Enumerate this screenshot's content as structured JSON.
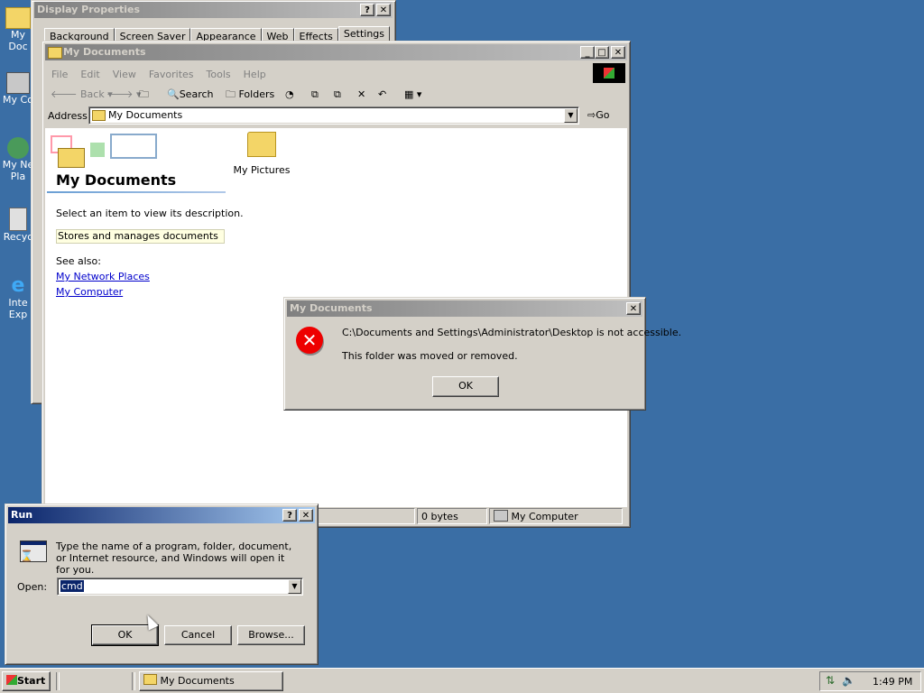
{
  "desktop": {
    "icons": [
      {
        "label": "My Doc"
      },
      {
        "label": "My Co"
      },
      {
        "label": "My Ne Pla"
      },
      {
        "label": "Recyc"
      },
      {
        "label": "Inte Exp"
      }
    ]
  },
  "display_properties": {
    "title": "Display Properties",
    "tabs": [
      "Background",
      "Screen Saver",
      "Appearance",
      "Web",
      "Effects",
      "Settings"
    ]
  },
  "explorer": {
    "title": "My Documents",
    "menu": [
      "File",
      "Edit",
      "View",
      "Favorites",
      "Tools",
      "Help"
    ],
    "toolbar": {
      "back": "Back",
      "search": "Search",
      "folders": "Folders"
    },
    "address_label": "Address",
    "address_value": "My Documents",
    "go_label": "Go",
    "panel_title": "My Documents",
    "panel_desc": "Select an item to view its description.",
    "panel_tooltip": "Stores and manages documents",
    "see_also": "See also:",
    "links": [
      "My Network Places",
      "My Computer"
    ],
    "items": [
      {
        "label": "My Pictures"
      }
    ],
    "status": {
      "size": "0 bytes",
      "zone": "My Computer"
    }
  },
  "error_dialog": {
    "title": "My Documents",
    "line1": "C:\\Documents and Settings\\Administrator\\Desktop is not accessible.",
    "line2": "This folder was moved or removed.",
    "ok": "OK"
  },
  "run_dialog": {
    "title": "Run",
    "description": "Type the name of a program, folder, document, or Internet resource, and Windows will open it for you.",
    "open_label": "Open:",
    "open_value": "cmd",
    "ok": "OK",
    "cancel": "Cancel",
    "browse": "Browse..."
  },
  "taskbar": {
    "start": "Start",
    "tasks": [
      {
        "label": "My Documents"
      }
    ],
    "clock": "1:49 PM"
  }
}
